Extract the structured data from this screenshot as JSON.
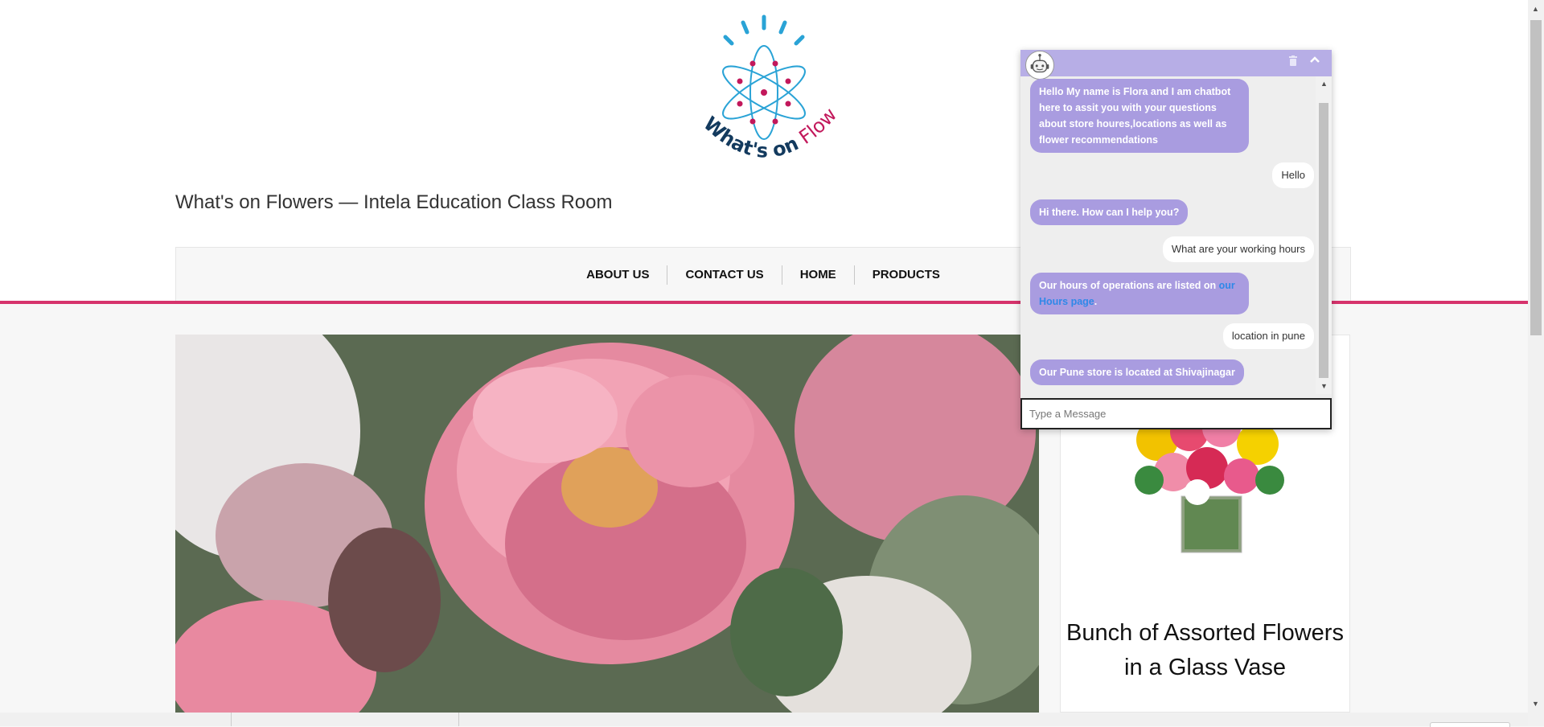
{
  "site": {
    "title": "What's on Flowers — Intela Education Class Room",
    "logo_text_part1": "What's on",
    "logo_text_part2": "Flowers",
    "colors": {
      "accent_pink": "#d6336c",
      "logo_blue": "#2aa3d6",
      "logo_navy": "#133a5e",
      "logo_magenta": "#c2185b"
    }
  },
  "nav": {
    "items": [
      {
        "label": "ABOUT US"
      },
      {
        "label": "CONTACT US"
      },
      {
        "label": "HOME"
      },
      {
        "label": "PRODUCTS"
      }
    ]
  },
  "product": {
    "title": "Bunch of Assorted Flowers in a Glass Vase"
  },
  "chat": {
    "header_color": "#b7aee6",
    "bot_bubble_color": "#a99ce0",
    "messages": [
      {
        "from": "bot",
        "text": "Hello My name is Flora and I am chatbot here to assit you with your questions about store houres,locations as well as flower recommendations"
      },
      {
        "from": "user",
        "text": "Hello"
      },
      {
        "from": "bot",
        "text": "Hi there. How can I help you?"
      },
      {
        "from": "user",
        "text": "What are your working hours"
      },
      {
        "from": "bot",
        "text": "Our hours of operations are listed on ",
        "link": "our Hours page",
        "after": "."
      },
      {
        "from": "user",
        "text": "location in pune"
      },
      {
        "from": "bot",
        "text": "Our Pune store is located at Shivajinagar"
      }
    ],
    "input_placeholder": "Type a Message",
    "input_value": ""
  }
}
